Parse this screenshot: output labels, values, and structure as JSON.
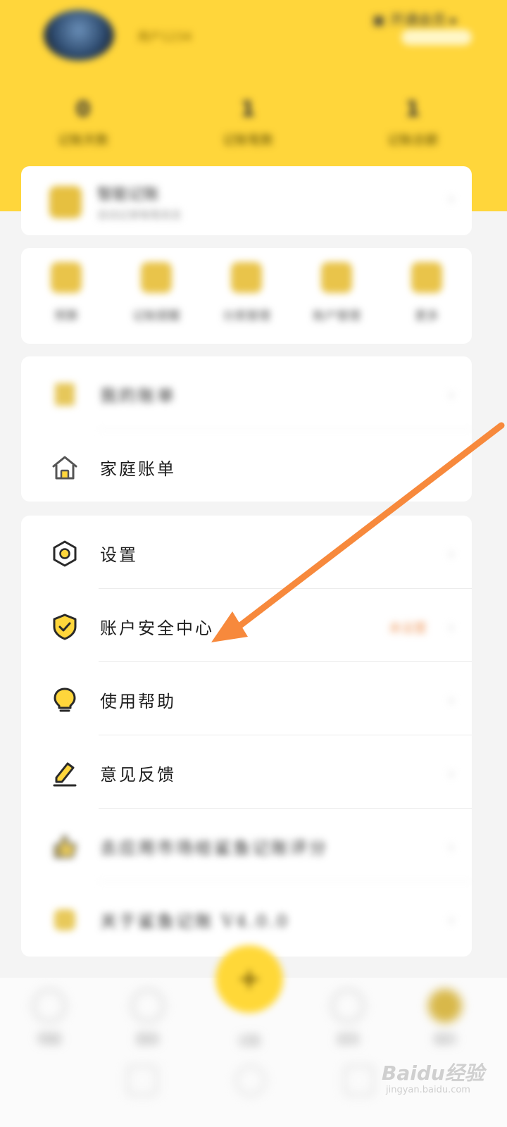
{
  "header": {
    "username": "用户1234",
    "right_text": "▣ 开通会员 ▸",
    "stats": [
      {
        "value": "0",
        "label": "记账天数"
      },
      {
        "value": "1",
        "label": "记账笔数"
      },
      {
        "value": "1",
        "label": "记账总额"
      }
    ]
  },
  "promo": {
    "title": "智能记账",
    "subtitle": "自动记录每笔收支"
  },
  "shortcuts": [
    {
      "label": "预算",
      "icon": "budget-icon"
    },
    {
      "label": "记账提醒",
      "icon": "reminder-icon"
    },
    {
      "label": "分类管理",
      "icon": "category-icon"
    },
    {
      "label": "账户管理",
      "icon": "account-icon"
    },
    {
      "label": "更多",
      "icon": "more-icon"
    }
  ],
  "menu1": [
    {
      "label": "我的账单",
      "icon": "bill-icon"
    },
    {
      "label": "家庭账单",
      "icon": "house-icon"
    }
  ],
  "menu2": [
    {
      "label": "设置",
      "icon": "gear-hexagon-icon"
    },
    {
      "label": "账户安全中心",
      "icon": "shield-check-icon",
      "badge": "未设置"
    },
    {
      "label": "使用帮助",
      "icon": "lightbulb-icon"
    },
    {
      "label": "意见反馈",
      "icon": "edit-pencil-icon"
    },
    {
      "label": "去应用市场给鲨鱼记账评分",
      "icon": "thumbs-up-icon"
    },
    {
      "label": "关于鲨鱼记账 V4.0.0",
      "icon": "info-icon"
    }
  ],
  "nav": [
    {
      "label": "明细",
      "icon": "list-icon"
    },
    {
      "label": "图表",
      "icon": "chart-icon"
    },
    {
      "label": "记账",
      "icon": "plus-icon"
    },
    {
      "label": "发现",
      "icon": "discover-icon"
    },
    {
      "label": "我的",
      "icon": "profile-icon"
    }
  ],
  "watermark": {
    "main": "Baidu经验",
    "sub": "jingyan.baidu.com"
  },
  "colors": {
    "accent": "#ffd63b",
    "arrow": "#f7893c"
  }
}
